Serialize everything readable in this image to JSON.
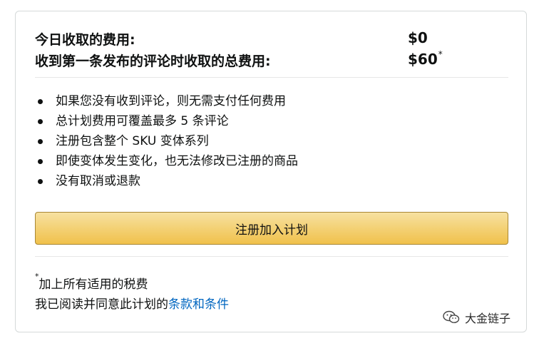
{
  "fees": {
    "today_label": "今日收取的费用:",
    "today_value": "$0",
    "total_label": "收到第一条发布的评论时收取的总费用:",
    "total_value": "$60",
    "total_marker": "*"
  },
  "bullets": [
    "如果您没有收到评论，则无需支付任何费用",
    "总计划费用可覆盖最多 5 条评论",
    "注册包含整个 SKU 变体系列",
    "即使变体发生变化，也无法修改已注册的商品",
    "没有取消或退款"
  ],
  "enroll_button": {
    "label": "注册加入计划",
    "color": "#f0c14b"
  },
  "footnote": {
    "marker": "*",
    "text": "加上所有适用的税费"
  },
  "terms": {
    "prefix": "我已阅读并同意此计划的",
    "link": "条款和条件",
    "link_color": "#0066c0"
  },
  "watermark": {
    "icon": "wechat-icon",
    "text": "大金链子"
  }
}
